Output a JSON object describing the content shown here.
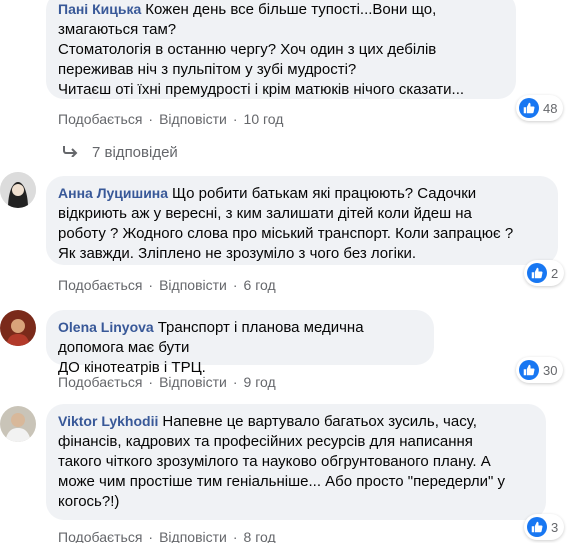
{
  "colors": {
    "accent": "#1877f2",
    "name": "#385898",
    "meta": "#65676b",
    "bubble": "#f0f2f5"
  },
  "icons": {
    "like": "thumbs-up-icon",
    "reply": "reply-arrow-icon"
  },
  "comments": [
    {
      "author": "Пані Кицька",
      "text": "Кожен день все більше тупості...Вони що,\nзмагаються там?\nСтоматологія в останню чергу? Хоч один з цих дебілів\nпереживав ніч з пульпітом у зубі мудрості?\nЧитаєш оті їхні премудрості і крім матюків нічого сказати...",
      "like_label": "Подобається",
      "reply_label": "Відповісти",
      "time": "10 год",
      "reactions": "48"
    },
    {
      "author": "Анна Луцишина",
      "text": "Що робити батькам які працюють? Садочки\nвідкриють аж у вересні, з ким залишати дітей коли йдеш на\nроботу ? Жодного слова про міський транспорт. Коли запрацює ?\nЯк завжди. Зліплено не зрозуміло з чого без логіки.",
      "like_label": "Подобається",
      "reply_label": "Відповісти",
      "time": "6 год",
      "reactions": "2"
    },
    {
      "author": "Olena Linyova",
      "text": "Транспорт і планова медична допомога має бути\nДО кінотеатрів і ТРЦ.",
      "like_label": "Подобається",
      "reply_label": "Відповісти",
      "time": "9 год",
      "reactions": "30"
    },
    {
      "author": "Viktor Lykhodii",
      "text": "Напевне це вартувало багатьох зусиль, часу,\nфінансів, кадрових та професійних ресурсів для написання\nтакого чіткого зрозумілого та науково обгрунтованого плану. А\nможе чим простіше тим геніальніше... Або просто \"передерли\" у\nкогось?!)",
      "like_label": "Подобається",
      "reply_label": "Відповісти",
      "time": "8 год",
      "reactions": "3"
    }
  ],
  "replies_link": "7 відповідей",
  "separator": "·"
}
